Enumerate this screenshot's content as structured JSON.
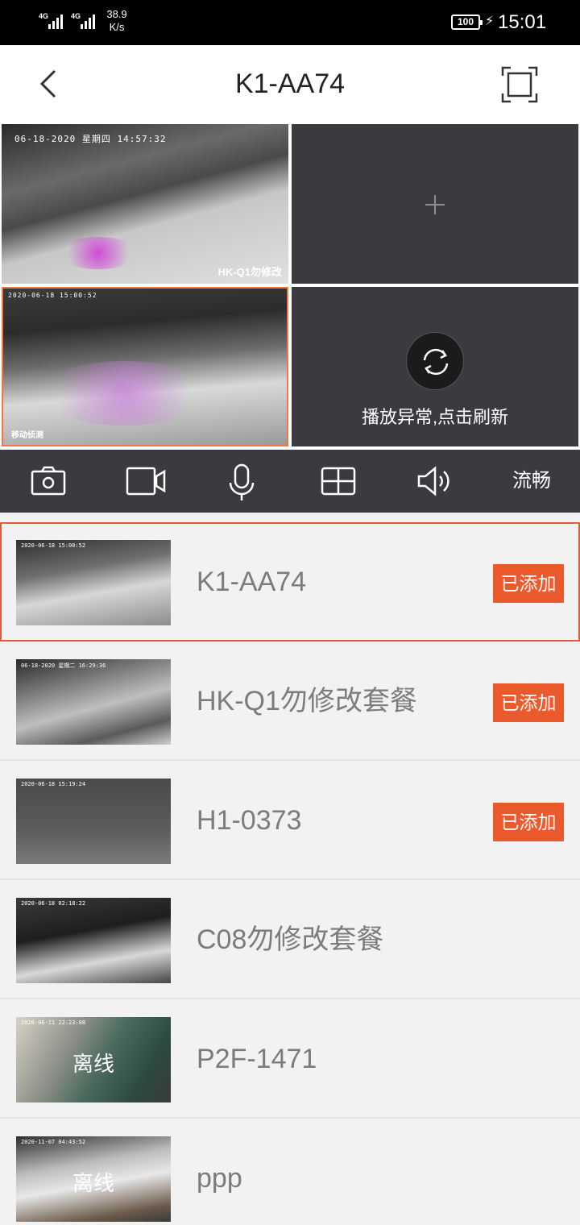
{
  "status_bar": {
    "network1": "4G",
    "network2": "4G",
    "speed_value": "38.9",
    "speed_unit": "K/s",
    "battery": "100",
    "time": "15:01"
  },
  "header": {
    "title": "K1-AA74",
    "back_icon": "chevron-left-icon",
    "fullscreen_icon": "fullscreen-icon"
  },
  "grid": {
    "tile1": {
      "timestamp": "06-18-2020 星期四 14:57:32",
      "label": "HK-Q1勿修改"
    },
    "tile3": {
      "timestamp": "2020-06-18 15:00:52",
      "label": "移动侦测"
    },
    "tile4": {
      "message": "播放异常,点击刷新"
    }
  },
  "toolbar": {
    "quality_label": "流畅",
    "icons": [
      "camera-icon",
      "video-record-icon",
      "microphone-icon",
      "grid-layout-icon",
      "speaker-icon"
    ]
  },
  "devices": [
    {
      "name": "K1-AA74",
      "badge": "已添加",
      "timestamp": "2020-06-18 15:00:52",
      "selected": true
    },
    {
      "name": "HK-Q1勿修改套餐",
      "badge": "已添加",
      "timestamp": "06-18-2020 星期二 16:29:36"
    },
    {
      "name": "H1-0373",
      "badge": "已添加",
      "timestamp": "2020-06-18 15:19:24"
    },
    {
      "name": "C08勿修改套餐",
      "timestamp": "2020-06-18 02:18:22"
    },
    {
      "name": "P2F-1471",
      "status": "离线",
      "timestamp": "2020-06-11 22:23:08"
    },
    {
      "name": "ppp",
      "status": "离线",
      "timestamp": "2020-11-07 04:43:52"
    }
  ]
}
